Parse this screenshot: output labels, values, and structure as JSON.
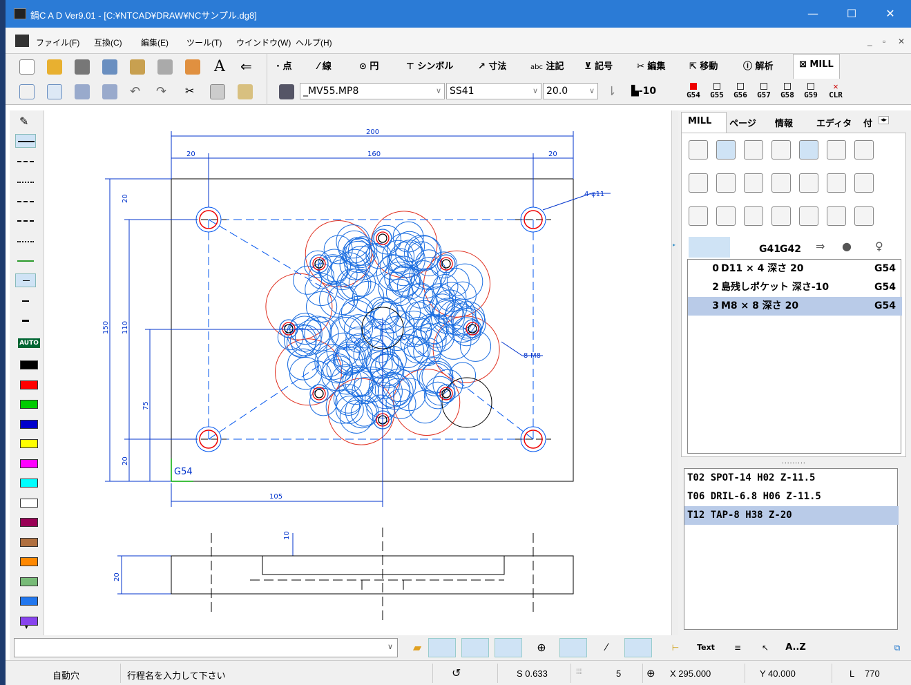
{
  "window": {
    "title": "鍋C A D Ver9.01 - [C:¥NTCAD¥DRAW¥NCサンプル.dg8]",
    "min": "—",
    "max": "☐",
    "close": "✕"
  },
  "menu": [
    "ファイル(F)",
    "互換(C)",
    "編集(E)",
    "ツール(T)",
    "ウインドウ(W)",
    "ヘルプ(H)"
  ],
  "mdi_controls": [
    "_",
    "▫",
    "✕"
  ],
  "mode_tabs": [
    "点",
    "線",
    "円",
    "シンボル",
    "寸法",
    "注記",
    "記号",
    "編集",
    "移動",
    "解析",
    "MILL"
  ],
  "toolbar2": {
    "machine": "_MV55.MP8",
    "material": "SS41",
    "value": "20.0",
    "z_label": "-10",
    "g_buttons": [
      "G54",
      "G55",
      "G56",
      "G57",
      "G58",
      "G59",
      "CLR"
    ]
  },
  "right_panel": {
    "tabs": [
      "MILL",
      "ページ",
      "情報",
      "エディタ",
      "付"
    ],
    "tool_row4": [
      "G41",
      "G42"
    ],
    "operations": [
      {
        "num": "0",
        "name": "D11 × 4 深さ 20",
        "g": "G54"
      },
      {
        "num": "2",
        "name": "島残しポケット 深さ-10",
        "g": "G54"
      },
      {
        "num": "3",
        "name": "M8 × 8 深さ 20",
        "g": "G54"
      }
    ],
    "tools": [
      "T02 SPOT-14 H02 Z-11.5",
      "T06 DRIL-6.8 H06 Z-11.5",
      "T12 TAP-8 H38 Z-20"
    ],
    "divider_dots": "........."
  },
  "palette": {
    "auto": "AUTO",
    "colors": [
      "#000000",
      "#ff0000",
      "#00cc00",
      "#0000cc",
      "#ffff00",
      "#ff00ff",
      "#00ffff",
      "#ffffff",
      "#990055",
      "#b07040",
      "#ff8800",
      "#77bb77",
      "#2277ee",
      "#8844ee"
    ]
  },
  "drawing": {
    "dims": {
      "d200": "200",
      "d20a": "20",
      "d160": "160",
      "d20b": "20",
      "d20c": "20",
      "d150": "150",
      "d110": "110",
      "d75": "75",
      "d20d": "20",
      "d105": "105",
      "d10": "10",
      "d20e": "20"
    },
    "notes": {
      "holes4": "4-φ11",
      "holes8": "8-M8",
      "origin": "G54"
    }
  },
  "cmd": {
    "buttons_right": [
      "Text",
      "A..Z"
    ]
  },
  "status": {
    "mode": "自動穴",
    "prompt": "行程名を入力して下さい",
    "scale": "S 0.633",
    "grid": "5",
    "x": "X 295.000",
    "y": "Y 40.000",
    "length_label": "L",
    "length": "770"
  }
}
